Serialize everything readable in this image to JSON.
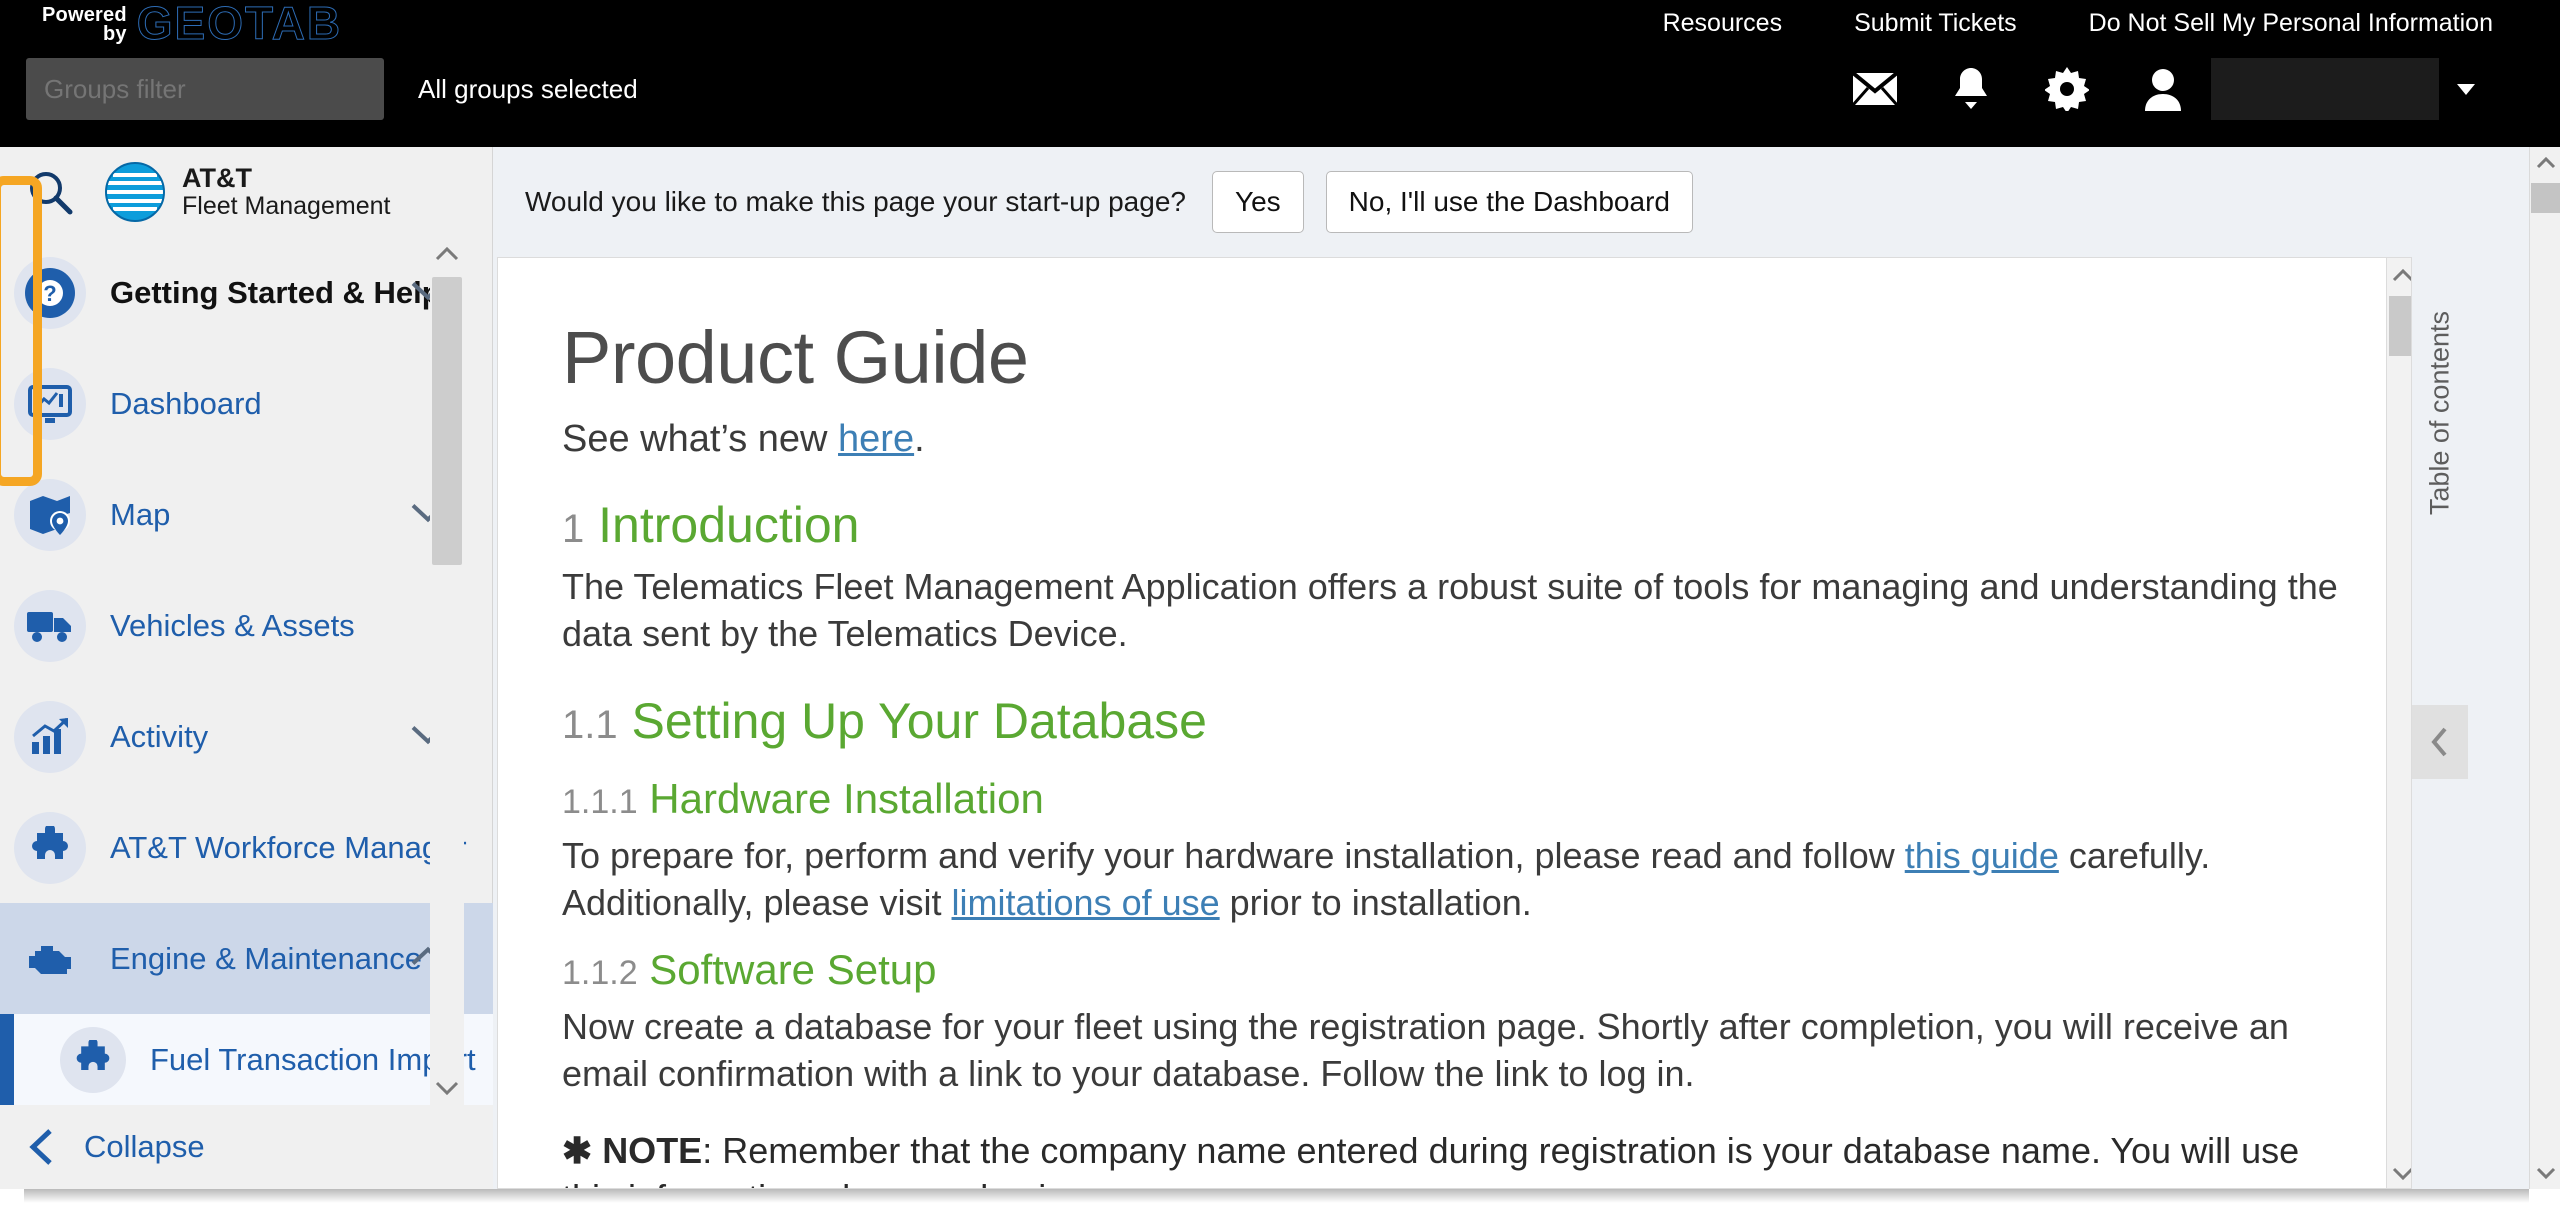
{
  "topbar": {
    "powered_line1": "Powered",
    "powered_line2": "by",
    "brand_logo": "GEOTAB",
    "links": [
      {
        "label": "Resources",
        "name": "resources"
      },
      {
        "label": "Submit Tickets",
        "name": "submit-tickets"
      },
      {
        "label": "Do Not Sell My Personal Information",
        "name": "do-not-sell"
      }
    ],
    "groups_filter_placeholder": "Groups filter",
    "groups_filter_value": "",
    "groups_status": "All groups selected",
    "icons": [
      "mail-icon",
      "bell-icon",
      "gear-icon",
      "user-icon"
    ],
    "user_name": ""
  },
  "sidebar": {
    "search_label": "Search",
    "brand_line1": "AT&T",
    "brand_line2": "Fleet Management",
    "items": [
      {
        "label": "Getting Started & Help",
        "icon": "help-circle-icon",
        "expandable": true,
        "expanded": false
      },
      {
        "label": "Dashboard",
        "icon": "dashboard-monitor-icon",
        "expandable": false
      },
      {
        "label": "Map",
        "icon": "map-pin-icon",
        "expandable": true,
        "expanded": false
      },
      {
        "label": "Vehicles & Assets",
        "icon": "truck-icon",
        "expandable": false
      },
      {
        "label": "Activity",
        "icon": "activity-chart-icon",
        "expandable": true,
        "expanded": false
      },
      {
        "label": "AT&T Workforce Manager",
        "icon": "puzzle-piece-icon",
        "expandable": false
      },
      {
        "label": "Engine & Maintenance",
        "icon": "engine-icon",
        "expandable": true,
        "expanded": true
      }
    ],
    "subitems": [
      {
        "label": "Fuel Transaction Import",
        "icon": "puzzle-piece-icon"
      }
    ],
    "collapse_label": "Collapse"
  },
  "startup_prompt": {
    "question": "Would you like to make this page your start-up page?",
    "yes_label": "Yes",
    "no_label": "No, I'll use the Dashboard"
  },
  "document": {
    "title": "Product Guide",
    "subtitle_before": "See what’s new ",
    "subtitle_link": "here",
    "subtitle_after": ".",
    "sections": [
      {
        "number": "1",
        "heading": "Introduction",
        "level": 1,
        "body_parts": [
          {
            "t": "The Telematics Fleet Management Application offers a robust suite of tools for managing and understanding the data sent by the Telematics Device."
          }
        ]
      },
      {
        "number": "1.1",
        "heading": "Setting Up Your Database",
        "level": 2,
        "body_parts": []
      },
      {
        "number": "1.1.1",
        "heading": "Hardware Installation",
        "level": 3,
        "body_parts": [
          {
            "t": "To prepare for, perform and verify your hardware installation, please read and follow "
          },
          {
            "t": "this guide",
            "link": true
          },
          {
            "t": " carefully. Additionally, please visit "
          },
          {
            "t": "limitations of use",
            "link": true
          },
          {
            "t": " prior to installation."
          }
        ]
      },
      {
        "number": "1.1.2",
        "heading": "Software Setup",
        "level": 3,
        "body_parts": [
          {
            "t": "Now create a database for your fleet using the registration page. Shortly after completion, you will receive an email confirmation with a link to your database. Follow the link to log in."
          }
        ]
      }
    ],
    "note_symbol": "✱",
    "note_label": "NOTE",
    "note_text": ": Remember that the company name entered during registration is your database name. You will use this information when you log in."
  },
  "toc": {
    "label": "Table of contents",
    "collapse_icon": "chevron-left-icon"
  },
  "colors": {
    "heading_green": "#5aa832",
    "link_blue": "#3d7fb5",
    "nav_blue": "#1f5eab",
    "highlight_orange": "#f5a623",
    "topbar_black": "#000000"
  }
}
